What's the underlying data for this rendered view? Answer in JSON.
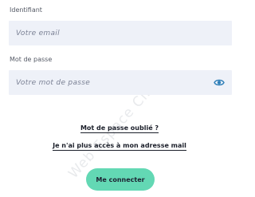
{
  "watermark": "Web Espace Client",
  "form": {
    "identifier_label": "Identifiant",
    "email_placeholder": "Votre email",
    "email_value": "",
    "password_label": "Mot de passe",
    "password_placeholder": "Votre mot de passe",
    "password_value": "",
    "show_password_icon": "eye-icon"
  },
  "links": {
    "forgot_password": "Mot de passe oublié ?",
    "lost_email_access": "Je n'ai plus accès à mon adresse mail"
  },
  "submit_label": "Me connecter",
  "colors": {
    "accent": "#63d8b4",
    "input_background": "#eef1f8",
    "eye_icon": "#2f7fb8",
    "text_dark": "#1b1f2a"
  }
}
